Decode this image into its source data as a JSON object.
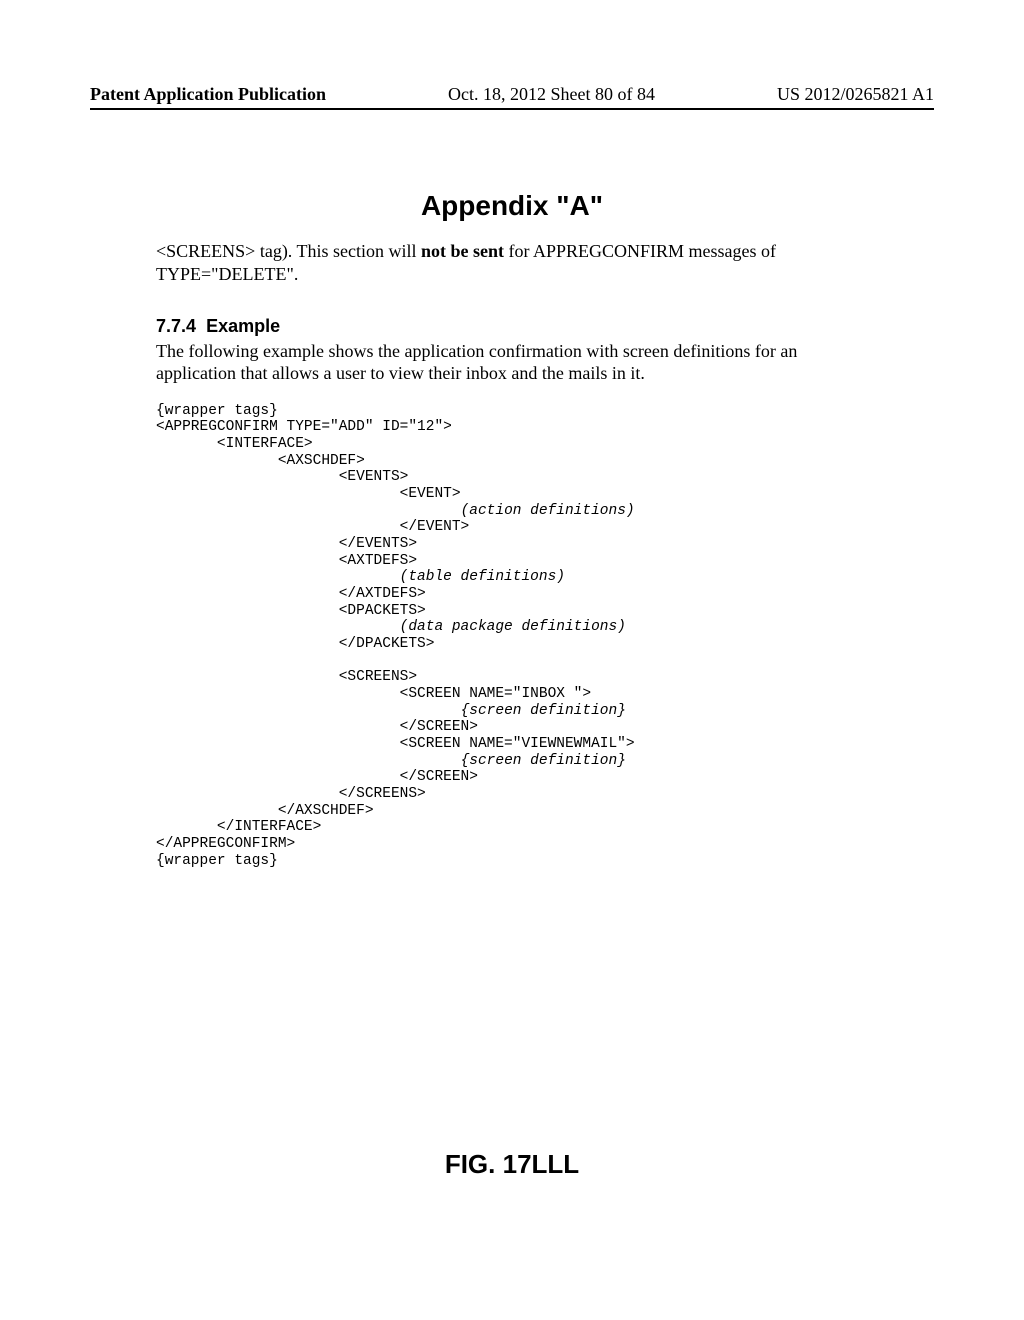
{
  "header": {
    "left": "Patent Application Publication",
    "center": "Oct. 18, 2012  Sheet 80 of 84",
    "right": "US 2012/0265821 A1"
  },
  "appendix_title": "Appendix \"A\"",
  "para1_pre": "<SCREENS> tag).  This section will ",
  "para1_bold": "not be sent",
  "para1_post": " for APPREGCONFIRM messages of TYPE=\"DELETE\".",
  "section_number": "7.7.4",
  "section_title": "Example",
  "para2": "The following example shows the application confirmation with screen definitions for an application that allows a user to view their inbox and the mails in it.",
  "code": {
    "l01": "{wrapper tags}",
    "l02": "<APPREGCONFIRM TYPE=\"ADD\" ID=\"12\">",
    "l03": "       <INTERFACE>",
    "l04": "              <AXSCHDEF>",
    "l05": "                     <EVENTS>",
    "l06": "                            <EVENT>",
    "l07_pre": "                                   ",
    "l07_it": "(action definitions)",
    "l08": "                            </EVENT>",
    "l09": "                     </EVENTS>",
    "l10": "                     <AXTDEFS>",
    "l11_pre": "                            ",
    "l11_it": "(table definitions)",
    "l12": "                     </AXTDEFS>",
    "l13": "                     <DPACKETS>",
    "l14_pre": "                            ",
    "l14_it": "(data package definitions)",
    "l15": "                     </DPACKETS>",
    "blank": "",
    "l16": "                     <SCREENS>",
    "l17": "                            <SCREEN NAME=\"INBOX \">",
    "l18_pre": "                                   ",
    "l18_it": "{screen definition}",
    "l19": "                            </SCREEN>",
    "l20": "                            <SCREEN NAME=\"VIEWNEWMAIL\">",
    "l21_pre": "                                   ",
    "l21_it": "{screen definition}",
    "l22": "                            </SCREEN>",
    "l23": "                     </SCREENS>",
    "l24": "              </AXSCHDEF>",
    "l25": "       </INTERFACE>",
    "l26": "</APPREGCONFIRM>",
    "l27": "{wrapper tags}"
  },
  "figure_label": "FIG. 17LLL"
}
